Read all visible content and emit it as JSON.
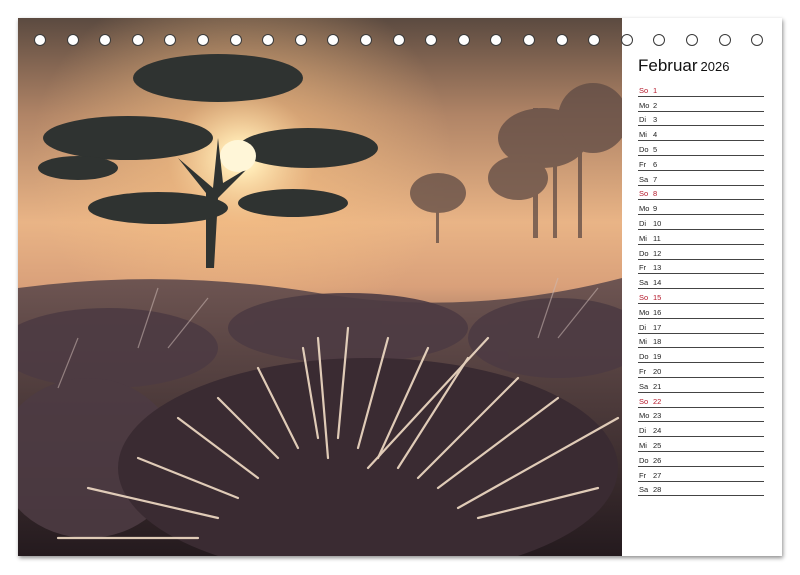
{
  "calendar": {
    "month": "Februar",
    "year": "2026",
    "colors": {
      "sunday": "#b4182a",
      "text": "#222222",
      "ring": "#3a3a3a"
    },
    "ring_count": 23,
    "days": [
      {
        "wd": "So",
        "num": "1",
        "sunday": true
      },
      {
        "wd": "Mo",
        "num": "2"
      },
      {
        "wd": "Di",
        "num": "3"
      },
      {
        "wd": "Mi",
        "num": "4"
      },
      {
        "wd": "Do",
        "num": "5"
      },
      {
        "wd": "Fr",
        "num": "6"
      },
      {
        "wd": "Sa",
        "num": "7"
      },
      {
        "wd": "So",
        "num": "8",
        "sunday": true
      },
      {
        "wd": "Mo",
        "num": "9"
      },
      {
        "wd": "Di",
        "num": "10"
      },
      {
        "wd": "Mi",
        "num": "11"
      },
      {
        "wd": "Do",
        "num": "12"
      },
      {
        "wd": "Fr",
        "num": "13"
      },
      {
        "wd": "Sa",
        "num": "14"
      },
      {
        "wd": "So",
        "num": "15",
        "sunday": true
      },
      {
        "wd": "Mo",
        "num": "16"
      },
      {
        "wd": "Di",
        "num": "17"
      },
      {
        "wd": "Mi",
        "num": "18"
      },
      {
        "wd": "Do",
        "num": "19"
      },
      {
        "wd": "Fr",
        "num": "20"
      },
      {
        "wd": "Sa",
        "num": "21"
      },
      {
        "wd": "So",
        "num": "22",
        "sunday": true
      },
      {
        "wd": "Mo",
        "num": "23"
      },
      {
        "wd": "Di",
        "num": "24"
      },
      {
        "wd": "Mi",
        "num": "25"
      },
      {
        "wd": "Do",
        "num": "26"
      },
      {
        "wd": "Fr",
        "num": "27"
      },
      {
        "wd": "Sa",
        "num": "28"
      }
    ]
  }
}
